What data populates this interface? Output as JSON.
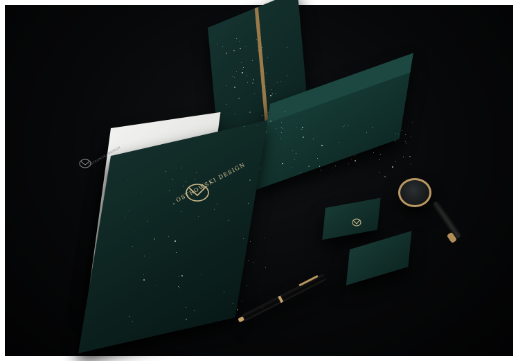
{
  "scene": {
    "description_items": [
      "letterhead",
      "folder",
      "notebook",
      "envelope",
      "business-card",
      "magnifying-glass",
      "fountain-pen"
    ],
    "colors": {
      "background": "#070809",
      "stationery": "#0f2a26",
      "accent_gold": "#b99863",
      "paper": "#ececea"
    }
  },
  "brand": {
    "name": "OSTROWSKI DESIGN"
  }
}
